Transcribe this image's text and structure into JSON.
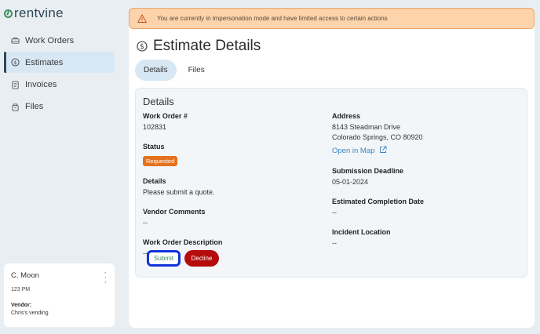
{
  "app": {
    "logo_text": "rentvine"
  },
  "sidebar": {
    "items": [
      {
        "label": "Work Orders",
        "icon": "toolbox-icon",
        "active": false
      },
      {
        "label": "Estimates",
        "icon": "dollar-circle-icon",
        "active": true
      },
      {
        "label": "Invoices",
        "icon": "invoice-icon",
        "active": false
      },
      {
        "label": "Files",
        "icon": "files-icon",
        "active": false
      }
    ]
  },
  "user": {
    "name": "C. Moon",
    "time": "123 PM",
    "vendor_label": "Vendor:",
    "vendor_name": "Chris's vending"
  },
  "banner": {
    "text": "You are currently in impersonation mode and have limited access to certain actions"
  },
  "page": {
    "title": "Estimate Details"
  },
  "tabs": [
    {
      "label": "Details",
      "active": true
    },
    {
      "label": "Files",
      "active": false
    }
  ],
  "details": {
    "heading": "Details",
    "work_order_label": "Work Order #",
    "work_order_value": "102831",
    "status_label": "Status",
    "status_value": "Requested",
    "details_label": "Details",
    "details_value": "Please submit a quote.",
    "vendor_comments_label": "Vendor Comments",
    "vendor_comments_value": "--",
    "description_label": "Work Order Description",
    "description_value": "--",
    "address_label": "Address",
    "address_line1": "8143 Steadman Drive",
    "address_line2": "Colorado Springs, CO 80920",
    "map_link": "Open in Map",
    "deadline_label": "Submission Deadline",
    "deadline_value": "05-01-2024",
    "completion_label": "Estimated Completion Date",
    "completion_value": "--",
    "incident_label": "Incident Location",
    "incident_value": "--"
  },
  "actions": {
    "submit": "Submit",
    "decline": "Decline"
  },
  "colors": {
    "accent": "#2e4755",
    "active_bg": "#d7e7f4",
    "status_orange": "#e4711e",
    "decline_red": "#b50d0d",
    "banner_bg": "#fcd3aa",
    "link_blue": "#3a86c8"
  }
}
